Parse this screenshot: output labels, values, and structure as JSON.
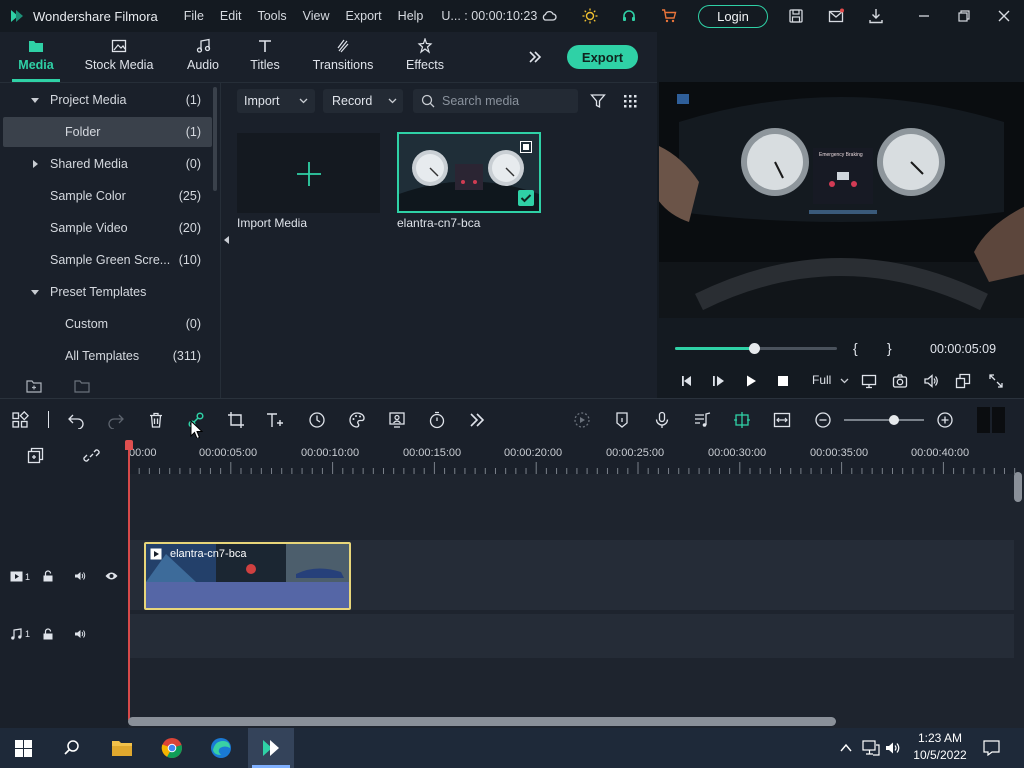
{
  "titlebar": {
    "app_name": "Wondershare Filmora",
    "menu": [
      "File",
      "Edit",
      "Tools",
      "View",
      "Export",
      "Help"
    ],
    "project": "U... : 00:00:10:23",
    "login_label": "Login"
  },
  "tabs": [
    {
      "label": "Media",
      "icon": "folder-icon",
      "active": true
    },
    {
      "label": "Stock Media",
      "icon": "image-icon"
    },
    {
      "label": "Audio",
      "icon": "music-icon"
    },
    {
      "label": "Titles",
      "icon": "text-icon"
    },
    {
      "label": "Transitions",
      "icon": "transition-icon"
    },
    {
      "label": "Effects",
      "icon": "effects-icon"
    }
  ],
  "export_label": "Export",
  "sidebar": {
    "items": [
      {
        "name": "Project Media",
        "count": "(1)",
        "expanded": true
      },
      {
        "name": "Folder",
        "count": "(1)",
        "selected": true
      },
      {
        "name": "Shared Media",
        "count": "(0)",
        "expanded": false
      },
      {
        "name": "Sample Color",
        "count": "(25)"
      },
      {
        "name": "Sample Video",
        "count": "(20)"
      },
      {
        "name": "Sample Green Scre...",
        "count": "(10)"
      },
      {
        "name": "Preset Templates",
        "count": "",
        "expanded": true
      },
      {
        "name": "Custom",
        "count": "(0)"
      },
      {
        "name": "All Templates",
        "count": "(311)"
      }
    ]
  },
  "media": {
    "import_label": "Import",
    "record_label": "Record",
    "search_placeholder": "Search media",
    "import_tile_label": "Import Media",
    "clip_name": "elantra-cn7-bca"
  },
  "preview": {
    "timecode": "00:00:05:09",
    "quality": "Full",
    "dashboard_text": "Emergency Braking",
    "progress": 0.49
  },
  "timeline": {
    "ruler": [
      "00:00",
      "00:00:05:00",
      "00:00:10:00",
      "00:00:15:00",
      "00:00:20:00",
      "00:00:25:00",
      "00:00:30:00",
      "00:00:35:00",
      "00:00:40:00"
    ],
    "video_track_num": "1",
    "audio_track_num": "1",
    "clip_name": "elantra-cn7-bca",
    "zoom": 0.62
  },
  "taskbar": {
    "time": "1:23 AM",
    "date": "10/5/2022"
  },
  "colors": {
    "accent": "#2fd1a6",
    "playhead": "#d74a4a",
    "clip_border": "#e8d67a"
  }
}
